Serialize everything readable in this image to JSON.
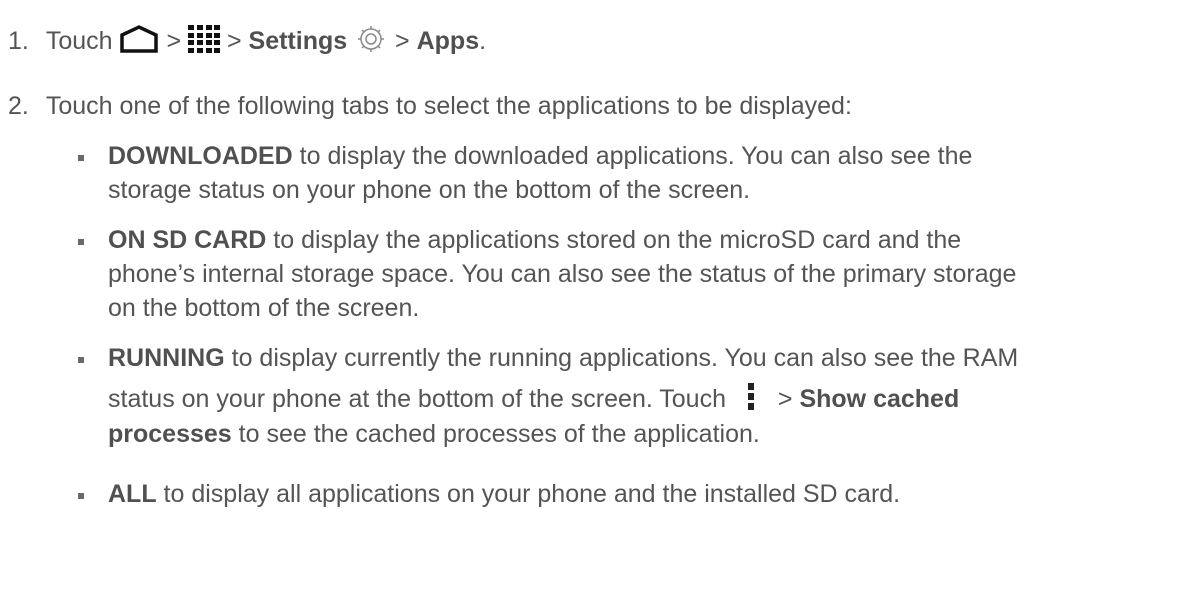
{
  "step1": {
    "number": "1.",
    "touch": "Touch",
    "sep1": ">",
    "sep2": ">",
    "settings": "Settings",
    "sep3": ">",
    "apps": "Apps",
    "period": ".",
    "icons": [
      "home-icon",
      "apps-grid-icon",
      "settings-gear-icon"
    ]
  },
  "step2": {
    "number": "2.",
    "text": "Touch one of the following tabs to select the applications to be displayed:"
  },
  "bullets": [
    {
      "term": "DOWNLOADED",
      "lines": [
        " to display the downloaded applications. You can also see the",
        "storage status on your phone on the bottom of the screen."
      ]
    },
    {
      "term": "ON SD CARD",
      "lines": [
        " to display the applications stored on the microSD card and the",
        "phone’s internal storage space. You can also see the status of the primary storage",
        "on the bottom of the screen."
      ]
    },
    {
      "term": "RUNNING",
      "lines": [
        " to display currently the running applications. You can also see the RAM",
        "status on your phone at the bottom of the screen. Touch",
        ">",
        "Show cached",
        "processes",
        " to see the cached processes of the application."
      ],
      "icon": "menu-dots-icon"
    },
    {
      "term": "ALL",
      "lines": [
        " to display all applications on your phone and the installed SD card."
      ]
    }
  ]
}
